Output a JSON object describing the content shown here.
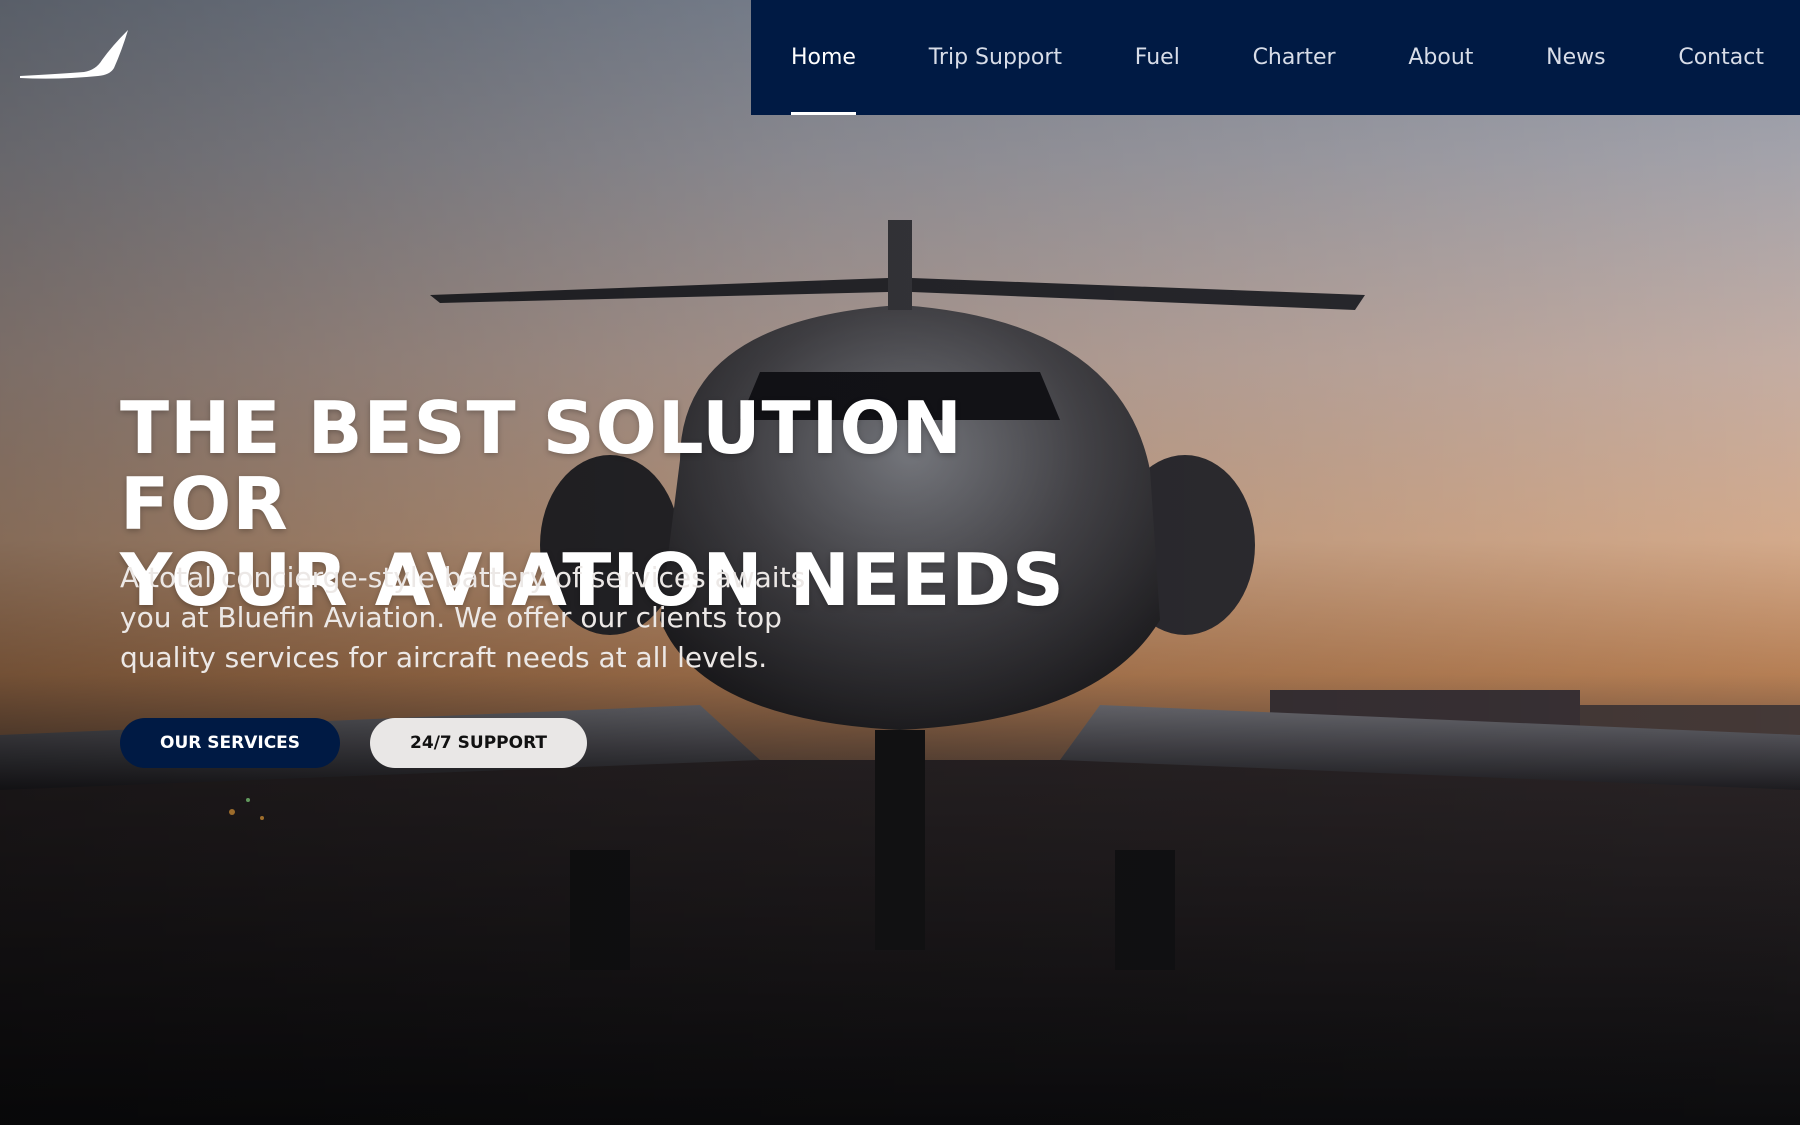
{
  "nav": {
    "items": [
      {
        "label": "Home",
        "active": true
      },
      {
        "label": "Trip Support",
        "active": false
      },
      {
        "label": "Fuel",
        "active": false
      },
      {
        "label": "Charter",
        "active": false
      },
      {
        "label": "About",
        "active": false
      },
      {
        "label": "News",
        "active": false
      },
      {
        "label": "Contact",
        "active": false
      }
    ]
  },
  "hero": {
    "headline_line1": "THE BEST SOLUTION FOR",
    "headline_line2": "YOUR AVIATION NEEDS",
    "subtext": "A total concierge-style battery of services awaits you at Bluefin Aviation. We offer our clients top quality services for aircraft needs at all levels.",
    "primary_button": "OUR SERVICES",
    "secondary_button": "24/7 SUPPORT"
  },
  "colors": {
    "nav_background": "#001a44",
    "primary_button": "#001a44",
    "secondary_button": "#e9e7e6"
  },
  "icons": {
    "logo": "bird-wing-logo-icon"
  }
}
